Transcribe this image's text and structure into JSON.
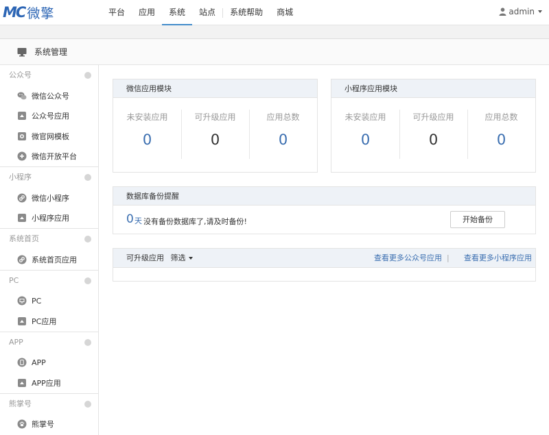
{
  "logo": {
    "mark": "MC",
    "text": "微擎"
  },
  "nav": {
    "items": [
      "平台",
      "应用",
      "系统",
      "站点",
      "系统帮助",
      "商城"
    ],
    "active_index": 2
  },
  "user": {
    "name": "admin",
    "icon": "user-icon"
  },
  "sysbar": {
    "title": "系统管理",
    "icon": "monitor-icon"
  },
  "sidebar": {
    "sections": [
      {
        "title": "公众号",
        "items": [
          {
            "label": "微信公众号",
            "icon": "wechat-icon"
          },
          {
            "label": "公众号应用",
            "icon": "app-icon"
          },
          {
            "label": "微官网模板",
            "icon": "template-icon"
          },
          {
            "label": "微信开放平台",
            "icon": "platform-icon"
          }
        ]
      },
      {
        "title": "小程序",
        "items": [
          {
            "label": "微信小程序",
            "icon": "miniprogram-icon"
          },
          {
            "label": "小程序应用",
            "icon": "app-icon"
          }
        ]
      },
      {
        "title": "系统首页",
        "items": [
          {
            "label": "系统首页应用",
            "icon": "home-app-icon"
          }
        ]
      },
      {
        "title": "PC",
        "items": [
          {
            "label": "PC",
            "icon": "pc-icon"
          },
          {
            "label": "PC应用",
            "icon": "app-icon"
          }
        ]
      },
      {
        "title": "APP",
        "items": [
          {
            "label": "APP",
            "icon": "phone-icon"
          },
          {
            "label": "APP应用",
            "icon": "app-icon"
          }
        ]
      },
      {
        "title": "熊掌号",
        "items": [
          {
            "label": "熊掌号",
            "icon": "paw-icon"
          }
        ]
      }
    ]
  },
  "wechat_panel": {
    "title": "微信应用模块",
    "stats": [
      {
        "label": "未安装应用",
        "value": "0"
      },
      {
        "label": "可升级应用",
        "value": "0"
      },
      {
        "label": "应用总数",
        "value": "0"
      }
    ]
  },
  "mini_panel": {
    "title": "小程序应用模块",
    "stats": [
      {
        "label": "未安装应用",
        "value": "0"
      },
      {
        "label": "可升级应用",
        "value": "0"
      },
      {
        "label": "应用总数",
        "value": "0"
      }
    ]
  },
  "backup": {
    "title": "数据库备份提醒",
    "days": "0",
    "unit": "天",
    "message": "没有备份数据库了,请及时备份!",
    "button": "开始备份"
  },
  "upgrade": {
    "title": "可升级应用",
    "filter": "筛选",
    "link_wechat": "查看更多公众号应用",
    "separator": "|",
    "link_mini": "查看更多小程序应用"
  },
  "colors": {
    "brand": "#2d66b5",
    "link": "#3a6eb0",
    "panel_head": "#eef2f7"
  }
}
